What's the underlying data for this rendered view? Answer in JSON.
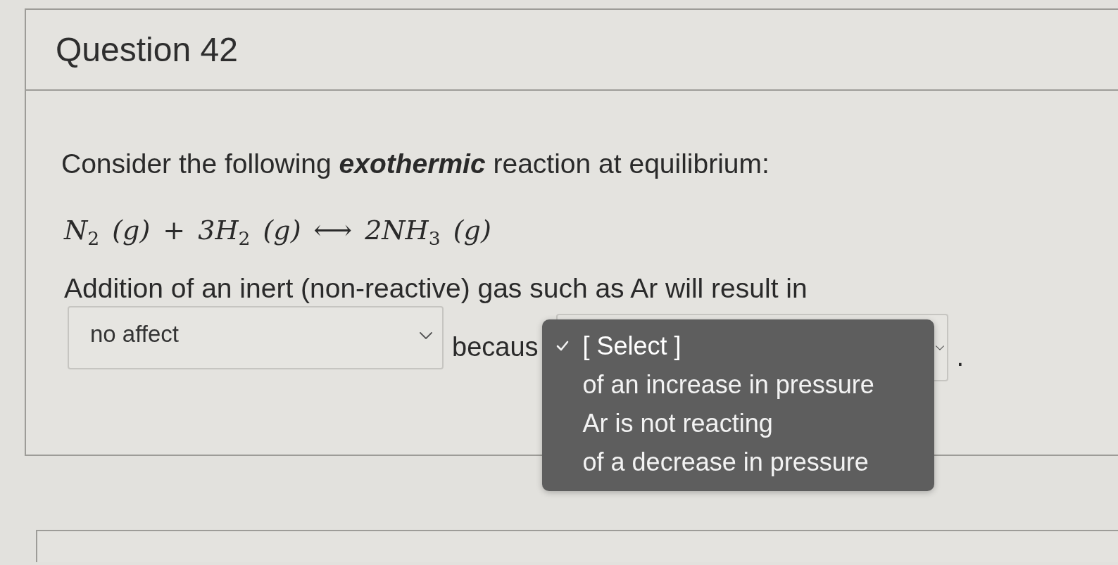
{
  "question": {
    "title": "Question 42",
    "prompt": "Consider the following *exothermic* reaction at equilibrium:",
    "equation": "N$_{2}$ (g) + 3H$_{2}$ (g) ⟷ 2NH$_{3}$ (g)",
    "statement": "Addition of an inert (non-reactive) gas such as Ar will result in",
    "answer_row": [
      {
        "kind": "select",
        "value": "no affect"
      },
      {
        "kind": "text",
        "text": "becaus"
      },
      {
        "kind": "select",
        "open": true,
        "options": [
          {
            "label": "[ Select ]",
            "selected": true
          },
          {
            "label": "of an increase in pressure",
            "selected": false
          },
          {
            "label": "Ar is not reacting",
            "selected": false
          },
          {
            "label": "of a decrease in pressure",
            "selected": false
          }
        ]
      },
      {
        "kind": "text",
        "text": "."
      }
    ]
  }
}
